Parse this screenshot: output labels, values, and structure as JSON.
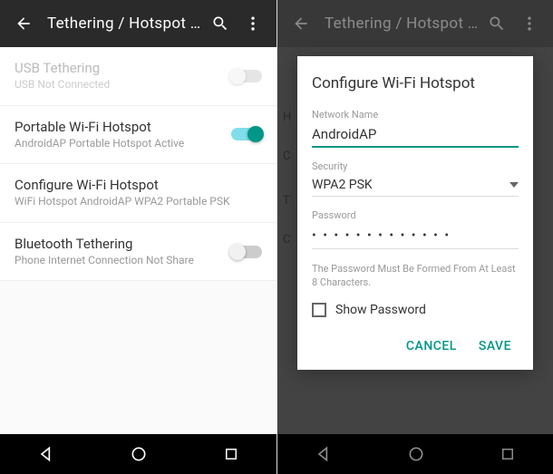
{
  "left": {
    "appbar": {
      "title": "Tethering / Hotspot P..."
    },
    "rows": {
      "usb": {
        "title": "USB Tethering",
        "sub": "USB Not Connected"
      },
      "wifi": {
        "title": "Portable Wi-Fi Hotspot",
        "sub": "AndroidAP Portable Hotspot Active"
      },
      "config": {
        "title": "Configure Wi-Fi Hotspot",
        "sub": "WiFi Hotspot AndroidAP WPA2 Portable PSK"
      },
      "bt": {
        "title": "Bluetooth Tethering",
        "sub": "Phone Internet Connection Not Share"
      }
    }
  },
  "right": {
    "appbar": {
      "title": "Tethering / Hotspot P..."
    },
    "bg": {
      "h": "H",
      "c": "C",
      "t": "T",
      "c2": "C"
    },
    "dialog": {
      "title": "Configure Wi-Fi Hotspot",
      "network_label": "Network Name",
      "network_value": "AndroidAP",
      "security_label": "Security",
      "security_value": "WPA2 PSK",
      "password_label": "Password",
      "password_value": "• • • • • • • • • • • • •",
      "hint": "The Password Must Be Formed From At Least 8 Characters.",
      "show_pw": "Show Password",
      "cancel": "CANCEL",
      "save": "SAVE"
    }
  }
}
